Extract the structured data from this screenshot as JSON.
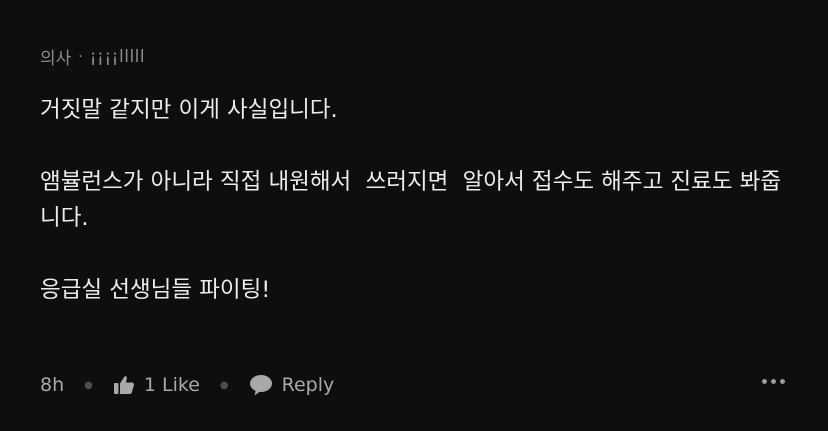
{
  "comment": {
    "author_role": "의사",
    "separator": "·",
    "author_name": "¡¡¡¡lllll",
    "paragraphs": [
      "거짓말 같지만 이게 사실입니다.",
      "앰뷸런스가 아니라 직접 내원해서  쓰러지면  알아서 접수도 해주고 진료도 봐줍니다.",
      "응급실 선생님들 파이팅!"
    ],
    "time": "8h",
    "like_label": "1 Like",
    "reply_label": "Reply"
  },
  "icons": {
    "like": "thumbs-up-icon",
    "reply": "speech-bubble-icon",
    "more": "more-options-icon"
  },
  "colors": {
    "background": "#0e0d0f",
    "text": "#ececec",
    "muted": "#8c8c8c"
  }
}
